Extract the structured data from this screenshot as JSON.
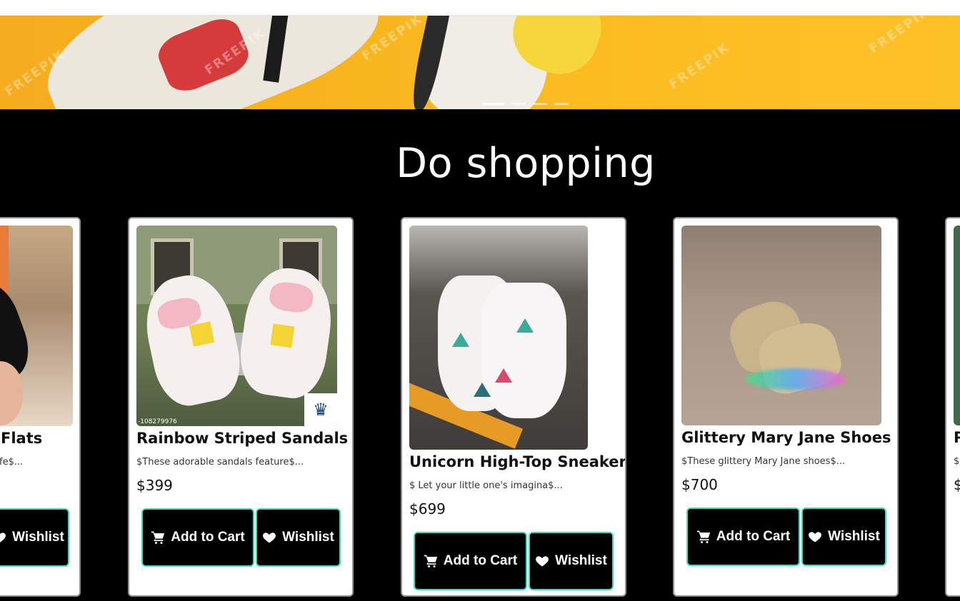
{
  "carousel": {
    "watermark": "FREEPIK",
    "slides": 4,
    "active_slide": 1
  },
  "section": {
    "title": "Do shopping"
  },
  "icons": {
    "cart": "cart-icon",
    "heart": "heart-icon",
    "crown": "crown-icon"
  },
  "accent_color": "#3fd9c0",
  "products": [
    {
      "name": "Flats",
      "desc": "fe$...",
      "wishlist_label": "Wishlist"
    },
    {
      "name": "Rainbow Striped Sandals",
      "desc": "$These adorable sandals feature$...",
      "price": "$399",
      "image_code": "-108279976",
      "cart_label": "Add to Cart",
      "wishlist_label": "Wishlist"
    },
    {
      "name": "Unicorn High-Top Sneakers",
      "desc": "$ Let your little one's imagina$...",
      "price": "$699",
      "cart_label": "Add to Cart",
      "wishlist_label": "Wishlist"
    },
    {
      "name": "Glittery Mary Jane Shoes",
      "desc": "$These glittery Mary Jane shoes$...",
      "price": "$700",
      "cart_label": "Add to Cart",
      "wishlist_label": "Wishlist"
    },
    {
      "name": "P",
      "desc": "$",
      "price": "$"
    }
  ]
}
